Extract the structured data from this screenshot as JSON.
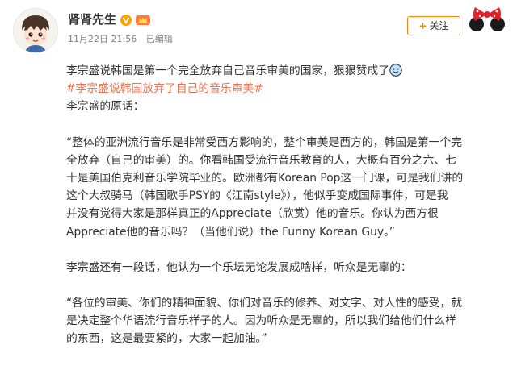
{
  "post": {
    "author": {
      "name": "肾肾先生"
    },
    "meta": {
      "date": "11月22日 21:56",
      "edited_label": "已编辑"
    },
    "follow_label": "关注",
    "lines": {
      "l1": "李宗盛说韩国是第一个完全放弃自己音乐审美的国家，狠狠赞成了",
      "hashtag": "#李宗盛说韩国放弃了自己的音乐审美#",
      "l3": "李宗盛的原话：",
      "q1_1": "“整体的亚洲流行音乐是非常受西方影响的，整个审美是西方的，韩国是第一个完",
      "q1_2": "全放弃（自己的审美）的。你看韩国受流行音乐教育的人，大概有百分之六、七",
      "q1_3": "十是美国伯克利音乐学院毕业的。欧洲都有Korean Pop这一门课，可是我们讲的",
      "q1_4": "这个大叔骑马（韩国歌手PSY的《江南style》），他似乎变成国际事件，可是我",
      "q1_5": "并没有觉得大家是那样真正的Appreciate（欣赏）他的音乐。你认为西方很",
      "q1_6": "Appreciate他的音乐吗？（当他们说）the Funny Korean Guy。”",
      "l10": "李宗盛还有一段话，他认为一个乐坛无论发展成啥样，听众是无辜的：",
      "q2_1": "“各位的审美、你们的精神面貌、你们对音乐的修养、对文字、对人性的感受，就",
      "q2_2": "是决定整个华语流行音乐样子的人。因为听众是无辜的，所以我们给他们什么样",
      "q2_3": "的东西，这是最要紧的，大家一起加油。”"
    }
  },
  "colors": {
    "hashtag": "#eb7350",
    "accent": "#ff8200",
    "verify": "#ffa200"
  },
  "icons": [
    "avatar-illustration",
    "verified-icon",
    "crown-badge-icon",
    "plus-icon",
    "minnie-decoration",
    "smile-emoji-icon"
  ]
}
